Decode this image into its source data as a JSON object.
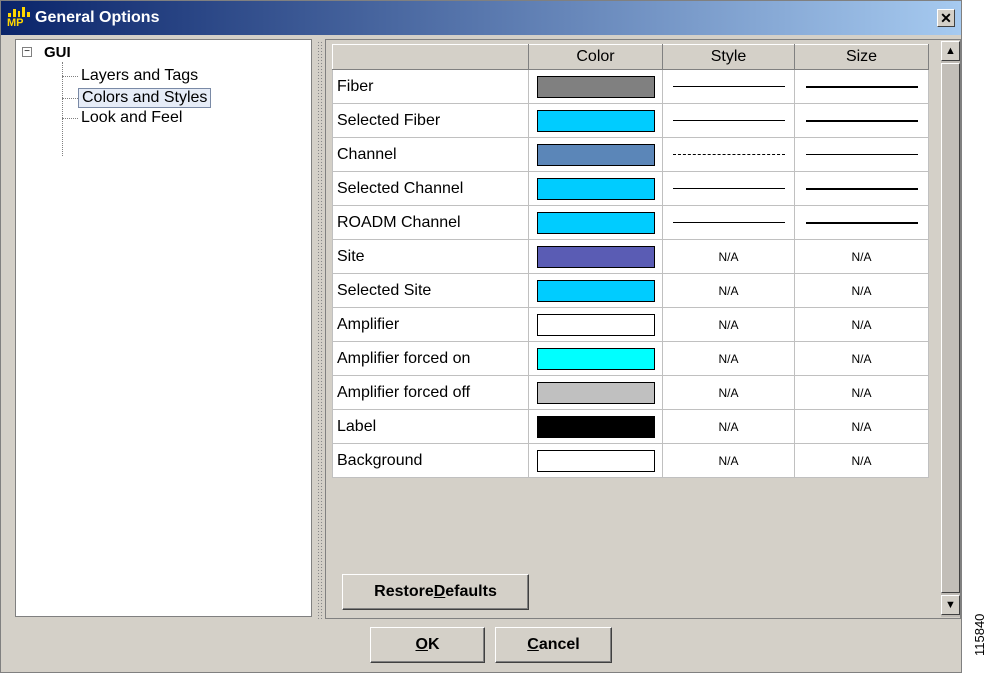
{
  "window": {
    "title": "General Options",
    "app_icon_text": "MP",
    "close_glyph": "✕"
  },
  "tree": {
    "root_label": "GUI",
    "expander_glyph": "−",
    "items": [
      {
        "label": "Layers and Tags",
        "selected": false
      },
      {
        "label": "Colors and Styles",
        "selected": true
      },
      {
        "label": "Look and Feel",
        "selected": false
      }
    ]
  },
  "table": {
    "headers": [
      "",
      "Color",
      "Style",
      "Size"
    ],
    "rows": [
      {
        "name": "Fiber",
        "color": "#808080",
        "style": "solid",
        "size": "thick"
      },
      {
        "name": "Selected Fiber",
        "color": "#00ccff",
        "style": "solid",
        "size": "thick"
      },
      {
        "name": "Channel",
        "color": "#5b86b8",
        "style": "dashed",
        "size": "thin"
      },
      {
        "name": "Selected Channel",
        "color": "#00ccff",
        "style": "solid",
        "size": "thick"
      },
      {
        "name": "ROADM Channel",
        "color": "#00ccff",
        "style": "solid",
        "size": "thick"
      },
      {
        "name": "Site",
        "color": "#5a5cb4",
        "style": "N/A",
        "size": "N/A"
      },
      {
        "name": "Selected Site",
        "color": "#00ccff",
        "style": "N/A",
        "size": "N/A"
      },
      {
        "name": "Amplifier",
        "color": "#ffffff",
        "style": "N/A",
        "size": "N/A"
      },
      {
        "name": "Amplifier forced on",
        "color": "#00ffff",
        "style": "N/A",
        "size": "N/A"
      },
      {
        "name": "Amplifier forced off",
        "color": "#c0c0c0",
        "style": "N/A",
        "size": "N/A"
      },
      {
        "name": "Label",
        "color": "#000000",
        "style": "N/A",
        "size": "N/A"
      },
      {
        "name": "Background",
        "color": "#ffffff",
        "style": "N/A",
        "size": "N/A"
      }
    ]
  },
  "buttons": {
    "restore_defaults": {
      "before": "Restore ",
      "mnemonic": "D",
      "after": "efaults"
    },
    "ok": {
      "before": "",
      "mnemonic": "O",
      "after": "K"
    },
    "cancel": {
      "before": "",
      "mnemonic": "C",
      "after": "ancel"
    }
  },
  "scrollbar": {
    "up_glyph": "▲",
    "down_glyph": "▼"
  },
  "figure_id": "115840"
}
